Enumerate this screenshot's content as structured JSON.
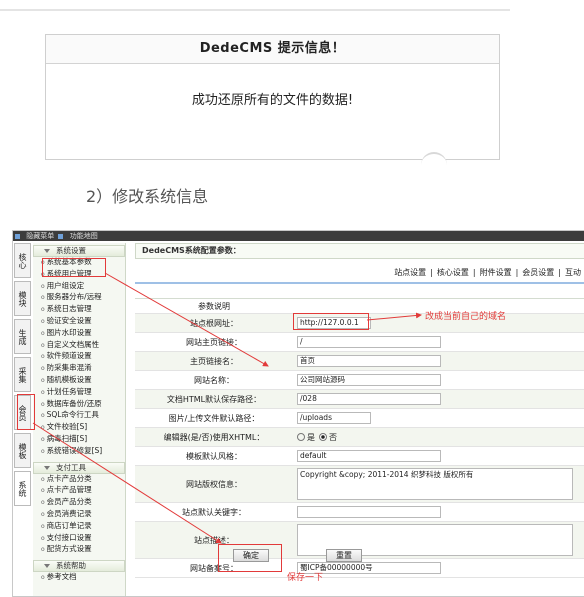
{
  "message_box": {
    "title": "DedeCMS 提示信息！",
    "message": "成功还原所有的文件的数据!"
  },
  "caption": "2）修改系统信息",
  "admin": {
    "topbar": {
      "hide_menu": "隐藏菜单",
      "function_map": "功能地图"
    },
    "vertical_tabs": [
      "核心",
      "模块",
      "生成",
      "采集",
      "会员",
      "模板",
      "系统"
    ],
    "menu": {
      "system_header": "系统设置",
      "system_items": [
        "系统基本参数",
        "系统用户管理",
        "用户组设定",
        "服务器分布/远程",
        "系统日志管理",
        "验证安全设置",
        "图片水印设置",
        "自定义文档属性",
        "软件频道设置",
        "防采集串混淆",
        "随机模板设置",
        "计划任务管理",
        "数据库备份/还原",
        "SQL命令行工具",
        "文件校验[S]",
        "病毒扫描[S]",
        "系统错误修复[S]"
      ],
      "pay_header": "支付工具",
      "pay_items": [
        "点卡产品分类",
        "点卡产品管理",
        "会员产品分类",
        "会员消费记录",
        "商店订单记录",
        "支付接口设置",
        "配货方式设置"
      ],
      "help_header": "系统帮助",
      "help_items": [
        "参考文档"
      ]
    },
    "content_title": "DedeCMS系统配置参数：",
    "tabs": [
      "站点设置",
      "核心设置",
      "附件设置",
      "会员设置",
      "互动"
    ],
    "tab_sep": "|",
    "form_header": "参数说明",
    "rows": [
      {
        "label": "站点根网址：",
        "value": "http://127.0.0.1"
      },
      {
        "label": "网站主页链接：",
        "value": "/"
      },
      {
        "label": "主页链接名：",
        "value": "首页"
      },
      {
        "label": "网站名称：",
        "value": "公司网站源码"
      },
      {
        "label": "文档HTML默认保存路径：",
        "value": "/028"
      },
      {
        "label": "图片/上传文件默认路径：",
        "value": "/uploads"
      },
      {
        "label": "编辑器(是/否)使用XHTML：",
        "options": [
          "是",
          "否"
        ],
        "selected": "否"
      },
      {
        "label": "模板默认风格：",
        "value": "default"
      },
      {
        "label": "网站版权信息：",
        "value": "Copyright &copy; 2011-2014 织梦科技 版权所有"
      },
      {
        "label": "站点默认关键字：",
        "value": ""
      },
      {
        "label": "站点描述：",
        "value": ""
      },
      {
        "label": "网站备案号：",
        "value": "蜀ICP备00000000号"
      }
    ],
    "confirm_button": "确定",
    "reset_button": "重置",
    "annotation_domain": "改成当前自己的域名",
    "annotation_save": "保存一下",
    "annotation_color": "#e23a3a"
  }
}
